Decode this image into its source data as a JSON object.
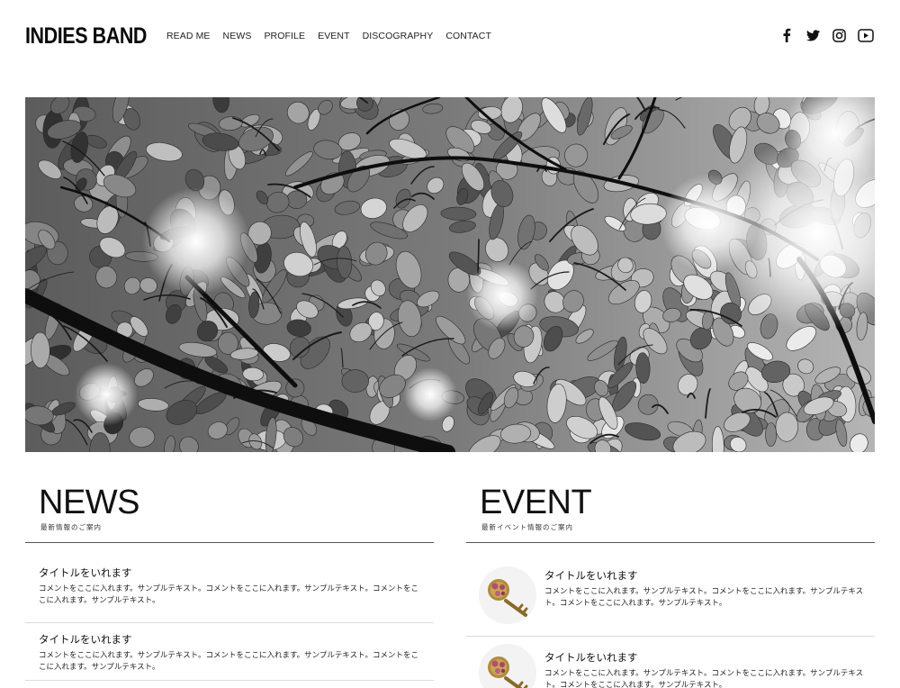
{
  "site": {
    "logo": "INDIES BAND"
  },
  "nav": {
    "items": [
      {
        "label": "READ ME"
      },
      {
        "label": "NEWS"
      },
      {
        "label": "PROFILE"
      },
      {
        "label": "EVENT"
      },
      {
        "label": "DISCOGRAPHY"
      },
      {
        "label": "CONTACT"
      }
    ]
  },
  "social": [
    "facebook-icon",
    "twitter-icon",
    "instagram-icon",
    "youtube-icon"
  ],
  "news": {
    "title": "NEWS",
    "subtitle": "最新情報のご案内",
    "items": [
      {
        "title": "タイトルをいれます",
        "body": "コメントをここに入れます。サンプルテキスト。コメントをここに入れます。サンプルテキスト。コメントをここに入れます。サンプルテキスト。"
      },
      {
        "title": "タイトルをいれます",
        "body": "コメントをここに入れます。サンプルテキスト。コメントをここに入れます。サンプルテキスト。コメントをここに入れます。サンプルテキスト。"
      }
    ]
  },
  "event": {
    "title": "EVENT",
    "subtitle": "最新イベント情報のご案内",
    "items": [
      {
        "title": "タイトルをいれます",
        "body": "コメントをここに入れます。サンプルテキスト。コメントをここに入れます。サンプルテキスト。コメントをここに入れます。サンプルテキスト。"
      },
      {
        "title": "タイトルをいれます",
        "body": "コメントをここに入れます。サンプルテキスト。コメントをここに入れます。サンプルテキスト。コメントをここに入れます。サンプルテキスト。"
      }
    ]
  }
}
